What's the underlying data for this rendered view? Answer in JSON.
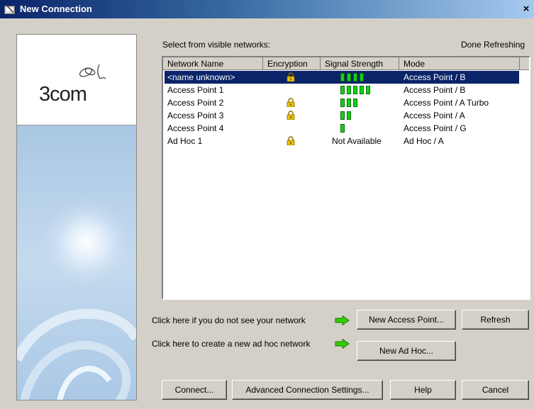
{
  "window": {
    "title": "New Connection",
    "close_glyph": "×"
  },
  "brand": {
    "logo_text": "3com"
  },
  "networks_section": {
    "label": "Select from visible networks:",
    "status": "Done Refreshing",
    "columns": [
      "Network Name",
      "Encryption",
      "Signal Strength",
      "Mode"
    ],
    "rows": [
      {
        "name": "<name unknown>",
        "encrypted": true,
        "signal_bars": 4,
        "signal_text": "",
        "mode": "Access Point / B",
        "selected": true
      },
      {
        "name": "Access Point 1",
        "encrypted": false,
        "signal_bars": 5,
        "signal_text": "",
        "mode": "Access Point / B",
        "selected": false
      },
      {
        "name": "Access Point 2",
        "encrypted": true,
        "signal_bars": 3,
        "signal_text": "",
        "mode": "Access Point / A Turbo",
        "selected": false
      },
      {
        "name": "Access Point 3",
        "encrypted": true,
        "signal_bars": 2,
        "signal_text": "",
        "mode": "Access Point / A",
        "selected": false
      },
      {
        "name": "Access Point 4",
        "encrypted": false,
        "signal_bars": 1,
        "signal_text": "",
        "mode": "Access Point / G",
        "selected": false
      },
      {
        "name": "Ad Hoc 1",
        "encrypted": true,
        "signal_bars": 0,
        "signal_text": "Not Available",
        "mode": "Ad Hoc / A",
        "selected": false
      }
    ]
  },
  "hints": {
    "no_network": "Click here if you do not see your network",
    "adhoc": "Click here to create a new ad hoc network"
  },
  "buttons": {
    "new_access_point": "New Access Point...",
    "refresh": "Refresh",
    "new_ad_hoc": "New Ad Hoc...",
    "connect": "Connect...",
    "advanced": "Advanced Connection Settings...",
    "help": "Help",
    "cancel": "Cancel"
  },
  "colors": {
    "selection": "#0a246a",
    "signal_bar": "#13d313",
    "arrow": "#33cc00",
    "lock": "#e6c200"
  },
  "icons": {
    "title": "window-icon",
    "lock": "lock-icon",
    "arrow": "green-arrow-icon"
  }
}
